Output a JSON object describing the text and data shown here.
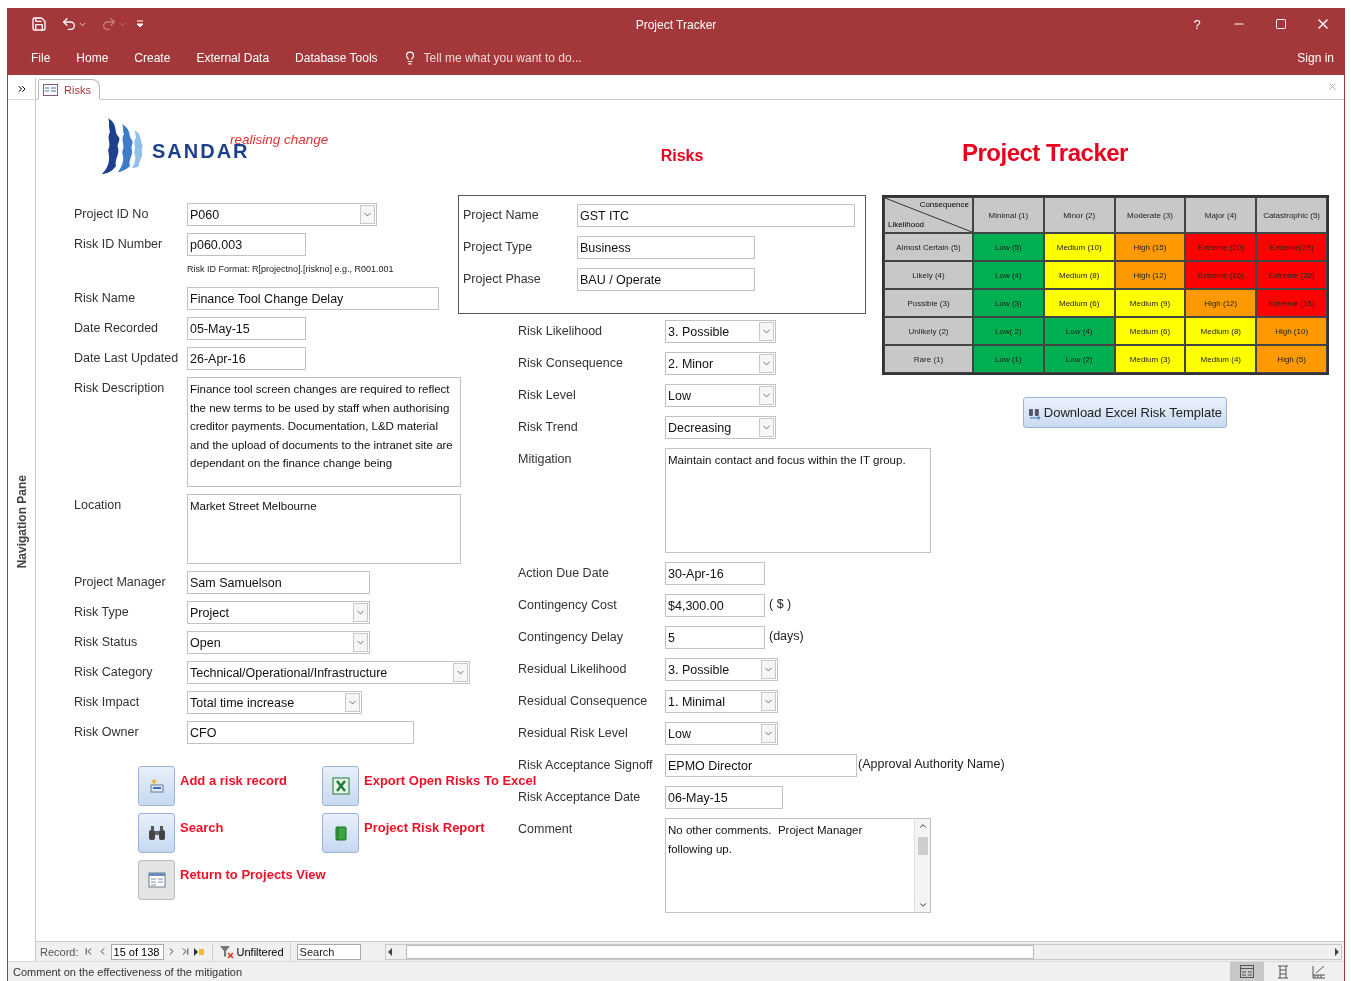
{
  "title_bar": {
    "quick_access": [
      {
        "kind": "save",
        "disabled": false
      },
      {
        "kind": "undo",
        "disabled": false
      },
      {
        "kind": "redo",
        "disabled": true
      }
    ],
    "title": "Project Tracker",
    "help": "?"
  },
  "ribbon": {
    "tabs": [
      "File",
      "Home",
      "Create",
      "External Data",
      "Database Tools"
    ],
    "tell_me": {
      "placeholder": "Tell me what you want to do..."
    },
    "sign_in": "Sign in"
  },
  "navigation_pane": {
    "label": "Navigation Pane"
  },
  "doc_tabs": [
    {
      "label": "Risks",
      "selected": true
    }
  ],
  "form": {
    "logo": {
      "name": "SANDAR",
      "tagline": "realising change"
    },
    "heading": "Risks",
    "app_title": "Project Tracker",
    "details": [
      {
        "label": "Project ID No",
        "kind": "combo",
        "value": "P060"
      },
      {
        "label": "Risk ID Number",
        "kind": "text",
        "value": "p060.003",
        "hint": "Risk ID Format: R[projectno].[riskno] e.g., R001.001"
      },
      {
        "label": "Risk Name",
        "kind": "text",
        "value": "Finance Tool Change Delay"
      },
      {
        "label": "Date Recorded",
        "kind": "text",
        "value": "05-May-15"
      },
      {
        "label": "Date Last Updated",
        "kind": "text",
        "value": "26-Apr-16"
      },
      {
        "label": "Risk Description",
        "kind": "memo",
        "value": "Finance tool screen changes are required to reflect the new terms to be used by staff when authorising creditor payments. Documentation, L&D material and the upload of documents to the intranet site are dependant on the finance change being"
      },
      {
        "label": "Location",
        "kind": "memo",
        "value": "Market Street Melbourne"
      },
      {
        "label": "Project Manager",
        "kind": "text",
        "value": "Sam Samuelson"
      },
      {
        "label": "Risk Type",
        "kind": "combo",
        "value": "Project"
      },
      {
        "label": "Risk Status",
        "kind": "combo",
        "value": "Open"
      },
      {
        "label": "Risk Category",
        "kind": "combo",
        "value": "Technical/Operational/Infrastructure"
      },
      {
        "label": "Risk Impact",
        "kind": "combo",
        "value": "Total time increase"
      },
      {
        "label": "Risk Owner",
        "kind": "text",
        "value": "CFO"
      }
    ],
    "project": [
      {
        "label": "Project Name",
        "value": "GST ITC"
      },
      {
        "label": "Project Type",
        "value": "Business"
      },
      {
        "label": "Project Phase",
        "value": "BAU / Operate"
      }
    ],
    "assessment": [
      {
        "label": "Risk Likelihood",
        "kind": "combo",
        "value": "3. Possible"
      },
      {
        "label": "Risk Consequence",
        "kind": "combo",
        "value": "2. Minor"
      },
      {
        "label": "Risk Level",
        "kind": "combo",
        "value": "Low"
      },
      {
        "label": "Risk Trend",
        "kind": "combo",
        "value": "Decreasing"
      },
      {
        "label": "Mitigation",
        "kind": "memo",
        "value": "Maintain contact and focus within the IT group."
      },
      {
        "label": "Action Due Date",
        "kind": "text",
        "value": "30-Apr-16"
      },
      {
        "label": "Contingency Cost",
        "kind": "text",
        "value": "$4,300.00",
        "suffix": "( $ )"
      },
      {
        "label": "Contingency Delay",
        "kind": "text",
        "value": "5",
        "suffix": "(days)"
      },
      {
        "label": "Residual Likelihood",
        "kind": "combo",
        "value": "3. Possible"
      },
      {
        "label": "Residual Consequence",
        "kind": "combo",
        "value": "1. Minimal"
      },
      {
        "label": "Residual Risk Level",
        "kind": "combo",
        "value": "Low"
      },
      {
        "label": "Risk Acceptance Signoff",
        "kind": "text",
        "value": "EPMO Director",
        "suffix": "(Approval Authority Name)"
      },
      {
        "label": "Risk Acceptance Date",
        "kind": "text",
        "value": "06-May-15"
      },
      {
        "label": "Comment",
        "kind": "scrollmemo",
        "value": "No other comments.  Project Manager following up."
      }
    ],
    "matrix": {
      "corner_top": "Consequence",
      "corner_bottom": "Likelihood",
      "columns": [
        "Minimal (1)",
        "Minor (2)",
        "Moderate (3)",
        "Major (4)",
        "Catastrophic (5)"
      ],
      "rows": [
        {
          "label": "Almost Certain (5)",
          "cells": [
            {
              "text": "Low (5)",
              "color": "#00b050"
            },
            {
              "text": "Medium (10)",
              "color": "#ffff00"
            },
            {
              "text": "High (15)",
              "color": "#ff9900"
            },
            {
              "text": "Extreme (20)",
              "color": "#ff0000"
            },
            {
              "text": "Extreme(25)",
              "color": "#ff0000"
            }
          ]
        },
        {
          "label": "Likely (4)",
          "cells": [
            {
              "text": "Low (4)",
              "color": "#00b050"
            },
            {
              "text": "Medium (8)",
              "color": "#ffff00"
            },
            {
              "text": "High (12)",
              "color": "#ff9900"
            },
            {
              "text": "Extreme (16)",
              "color": "#ff0000"
            },
            {
              "text": "Extreme (20)",
              "color": "#ff0000"
            }
          ]
        },
        {
          "label": "Possible (3)",
          "cells": [
            {
              "text": "Low (3)",
              "color": "#00b050"
            },
            {
              "text": "Medium (6)",
              "color": "#ffff00"
            },
            {
              "text": "Medium (9)",
              "color": "#ffff00"
            },
            {
              "text": "High (12)",
              "color": "#ff9900"
            },
            {
              "text": "Extreme (15)",
              "color": "#ff0000"
            }
          ]
        },
        {
          "label": "Unlikely (2)",
          "cells": [
            {
              "text": "Low( 2)",
              "color": "#00b050"
            },
            {
              "text": "Low (4)",
              "color": "#00b050"
            },
            {
              "text": "Medium (6)",
              "color": "#ffff00"
            },
            {
              "text": "Medium (8)",
              "color": "#ffff00"
            },
            {
              "text": "High (10)",
              "color": "#ff9900"
            }
          ]
        },
        {
          "label": "Rare (1)",
          "cells": [
            {
              "text": "Low (1)",
              "color": "#00b050"
            },
            {
              "text": "Low (2)",
              "color": "#00b050"
            },
            {
              "text": "Medium (3)",
              "color": "#ffff00"
            },
            {
              "text": "Medium (4)",
              "color": "#ffff00"
            },
            {
              "text": "High (5)",
              "color": "#ff9900"
            }
          ]
        }
      ]
    },
    "download_button": "Download Excel Risk Template",
    "actions": [
      {
        "kind": "add",
        "label": "Add a risk record"
      },
      {
        "kind": "excel",
        "label": "Export Open Risks To Excel"
      },
      {
        "kind": "search",
        "label": "Search"
      },
      {
        "kind": "report",
        "label": "Project Risk Report"
      },
      {
        "kind": "return",
        "label": "Return to Projects View"
      }
    ]
  },
  "record_nav": {
    "label": "Record:",
    "position": "15 of 138",
    "filter": "Unfiltered",
    "search": {
      "placeholder": "Search"
    }
  },
  "status_bar": {
    "text": "Comment on the effectiveness of the mitigation",
    "views": [
      {
        "kind": "form",
        "selected": true
      },
      {
        "kind": "layout",
        "selected": false
      },
      {
        "kind": "design",
        "selected": false
      }
    ]
  }
}
